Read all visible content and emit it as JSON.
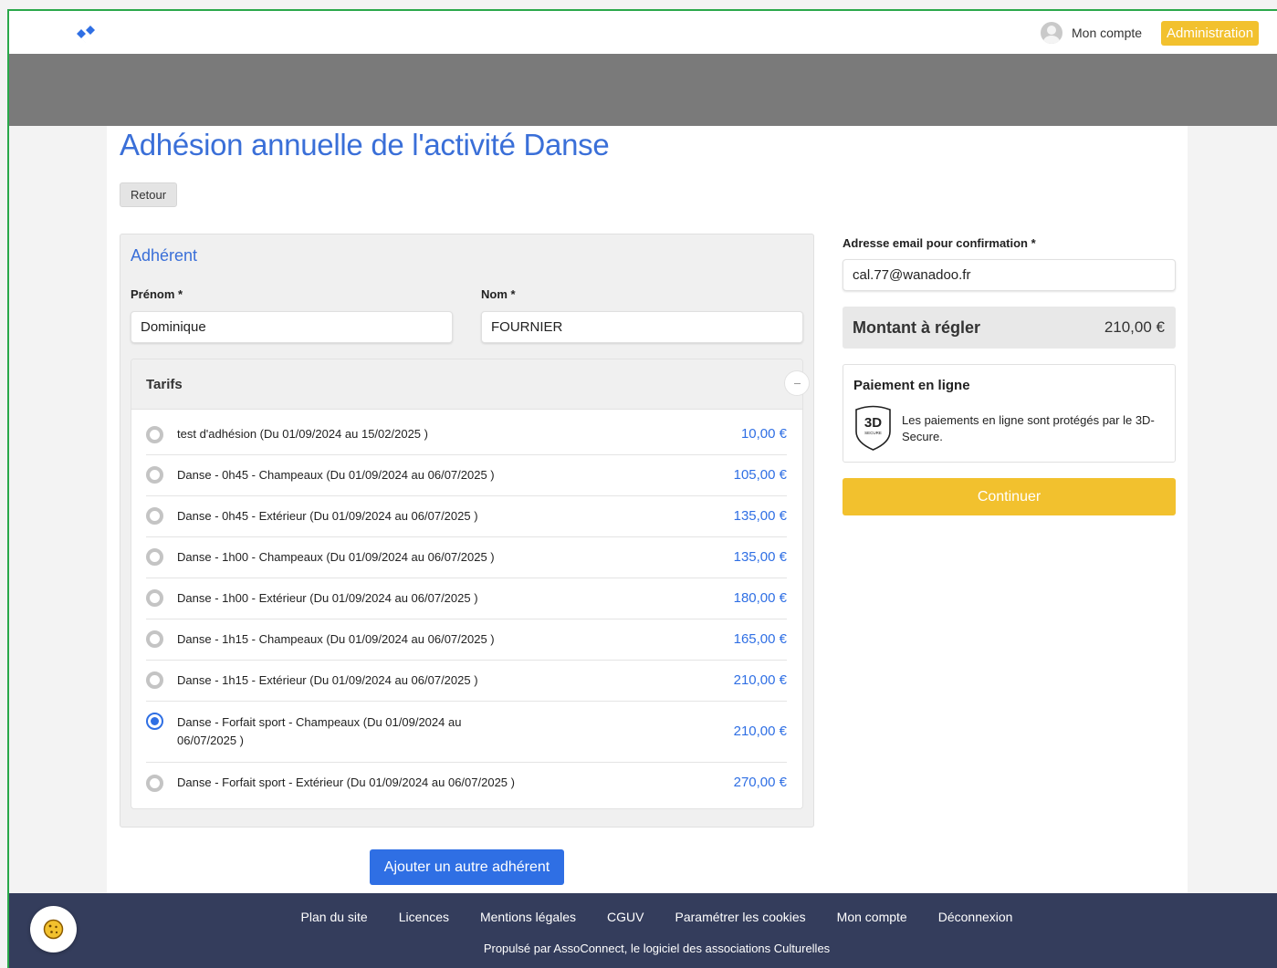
{
  "header": {
    "account_label": "Mon compte",
    "admin_label": "Administration"
  },
  "page": {
    "title": "Adhésion annuelle de l'activité Danse",
    "back_label": "Retour"
  },
  "member": {
    "section_title": "Adhérent",
    "first_name_label": "Prénom *",
    "first_name_value": "Dominique",
    "last_name_label": "Nom *",
    "last_name_value": "FOURNIER"
  },
  "tarifs": {
    "heading": "Tarifs",
    "items": [
      {
        "label": "test d'adhésion (Du 01/09/2024 au 15/02/2025 )",
        "price": "10,00 €",
        "selected": false
      },
      {
        "label": "Danse - 0h45 - Champeaux (Du 01/09/2024 au 06/07/2025 )",
        "price": "105,00 €",
        "selected": false
      },
      {
        "label": "Danse - 0h45 - Extérieur (Du 01/09/2024 au 06/07/2025 )",
        "price": "135,00 €",
        "selected": false
      },
      {
        "label": "Danse - 1h00 - Champeaux (Du 01/09/2024 au 06/07/2025 )",
        "price": "135,00 €",
        "selected": false
      },
      {
        "label": "Danse - 1h00 - Extérieur (Du 01/09/2024 au 06/07/2025 )",
        "price": "180,00 €",
        "selected": false
      },
      {
        "label": "Danse - 1h15 - Champeaux (Du 01/09/2024 au 06/07/2025 )",
        "price": "165,00 €",
        "selected": false
      },
      {
        "label": "Danse - 1h15 - Extérieur (Du 01/09/2024 au 06/07/2025 )",
        "price": "210,00 €",
        "selected": false
      },
      {
        "label": "Danse - Forfait sport - Champeaux (Du 01/09/2024 au 06/07/2025 )",
        "price": "210,00 €",
        "selected": true
      },
      {
        "label": "Danse - Forfait sport - Extérieur (Du 01/09/2024 au 06/07/2025 )",
        "price": "270,00 €",
        "selected": false
      }
    ]
  },
  "add_member_label": "Ajouter un autre adhérent",
  "summary": {
    "email_label": "Adresse email pour confirmation *",
    "email_value": "cal.77@wanadoo.fr",
    "amount_label": "Montant à régler",
    "amount_value": "210,00 €",
    "payment_title": "Paiement en ligne",
    "payment_text": "Les paiements en ligne sont protégés par le 3D-Secure.",
    "badge_text": "3D",
    "badge_subtext": "SECURE",
    "continue_label": "Continuer"
  },
  "footer": {
    "links": [
      "Plan du site",
      "Licences",
      "Mentions légales",
      "CGUV",
      "Paramétrer les cookies",
      "Mon compte",
      "Déconnexion"
    ],
    "powered_by": "Propulsé par AssoConnect, le logiciel des associations Culturelles"
  },
  "colors": {
    "accent_blue": "#2f6fe4",
    "title_blue": "#3a6fd8",
    "yellow": "#f2c12e",
    "footer_navy": "#343d5c",
    "banner_gray": "#7a7a7a",
    "frame_green": "#2aa84a"
  },
  "icons": {
    "logo": "assoconnect-logo-icon",
    "avatar": "user-avatar-icon",
    "shield": "3d-secure-shield-icon",
    "cookie": "cookie-icon",
    "collapse": "minus-icon"
  }
}
